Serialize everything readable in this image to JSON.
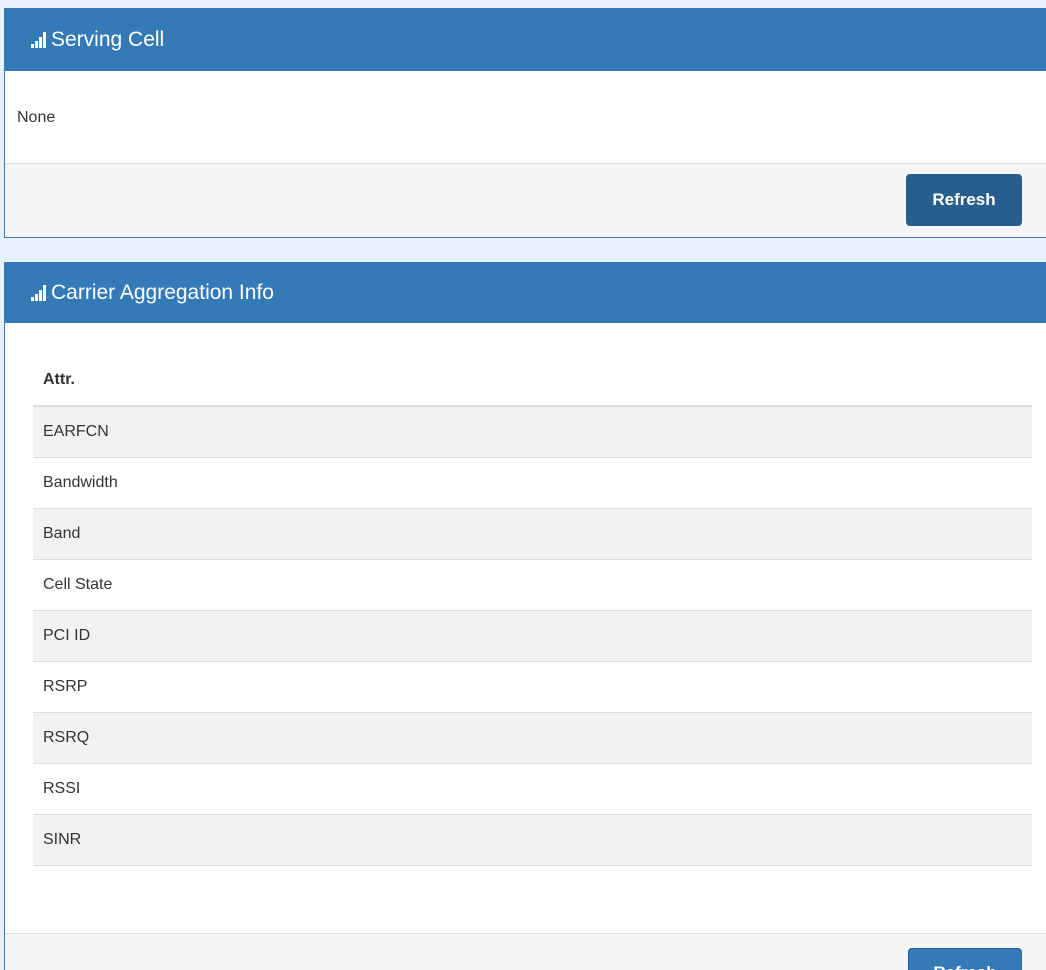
{
  "serving_cell": {
    "title": "Serving Cell",
    "icon": "signal-bars-icon",
    "body_text": "None",
    "refresh_label": "Refresh"
  },
  "carrier_aggregation": {
    "title": "Carrier Aggregation Info",
    "icon": "signal-bars-icon",
    "table": {
      "header": "Attr.",
      "rows": [
        "EARFCN",
        "Bandwidth",
        "Band",
        "Cell State",
        "PCI ID",
        "RSRP",
        "RSRQ",
        "RSSI",
        "SINR"
      ]
    },
    "refresh_label": "Refresh"
  },
  "colors": {
    "heading_bg": "#337ab7",
    "page_bg": "#e6f1fb",
    "button_bg": "#337ab7",
    "footer_bg": "#f5f5f5",
    "stripe_bg": "#f2f2f2"
  }
}
